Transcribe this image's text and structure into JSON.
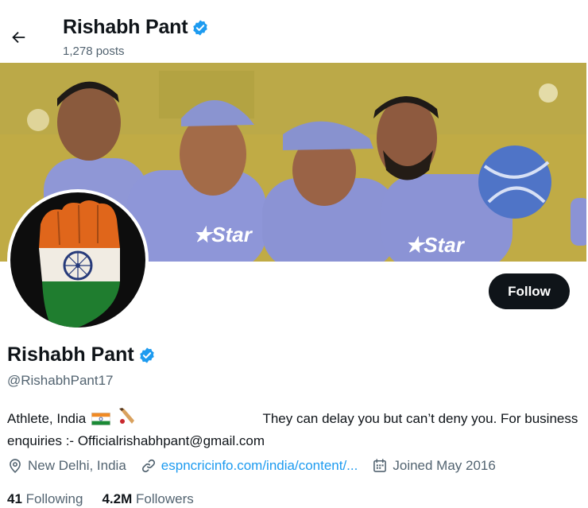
{
  "header": {
    "title": "Rishabh Pant",
    "posts": "1,278 posts"
  },
  "profile": {
    "name": "Rishabh Pant",
    "handle": "@RishabhPant17",
    "follow_label": "Follow",
    "bio_start": "Athlete, India",
    "bio_rest": "They can delay you but can’t deny you.  For business enquiries :- Officialrishabhpant@gmail.com",
    "location": "New Delhi, India",
    "website": "espncricinfo.com/india/content/...",
    "joined": "Joined May 2016",
    "following_count": "41",
    "following_label": "Following",
    "followers_count": "4.2M",
    "followers_label": "Followers"
  },
  "colors": {
    "accent": "#1d9bf0",
    "text": "#0f1419",
    "muted": "#536471",
    "button": "#0f1419"
  },
  "icons": {
    "back": "arrow-left-icon",
    "verified": "verified-badge-icon",
    "location": "location-pin-icon",
    "link": "link-icon",
    "calendar": "calendar-icon"
  }
}
